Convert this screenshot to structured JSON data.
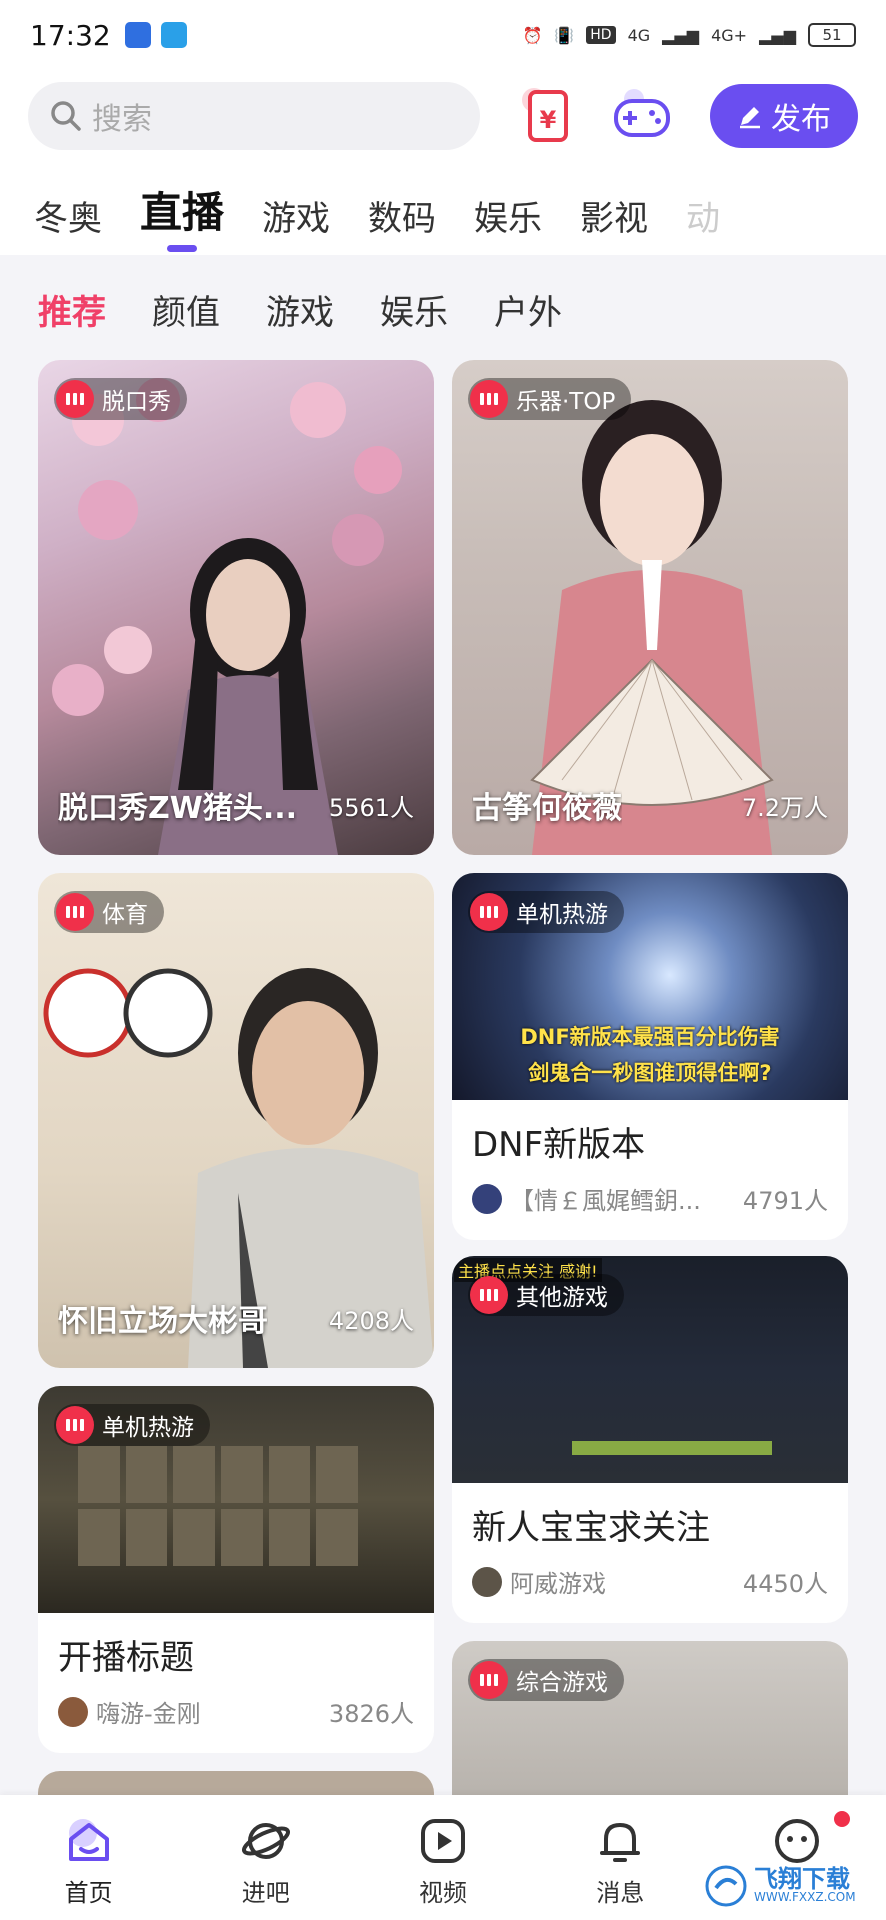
{
  "status_bar": {
    "time": "17:32",
    "hd": "HD",
    "net1": "4G",
    "net2": "4G+",
    "battery": "51"
  },
  "search": {
    "placeholder": "搜索"
  },
  "publish_label": "发布",
  "category_tabs": [
    "冬奥",
    "直播",
    "游戏",
    "数码",
    "娱乐",
    "影视",
    "动"
  ],
  "sub_tabs": [
    "推荐",
    "颜值",
    "游戏",
    "娱乐",
    "户外"
  ],
  "cards": [
    {
      "tag": "脱口秀",
      "title": "脱口秀ZW猪头...",
      "viewers": "5561人"
    },
    {
      "tag": "乐器·TOP",
      "title": "古筝何筱薇",
      "viewers": "7.2万人"
    },
    {
      "tag": "体育",
      "title": "怀旧立场大彬哥",
      "viewers": "4208人"
    },
    {
      "tag": "单机热游",
      "title": "DNF新版本",
      "streamer": "【情￡風娓鳕鈅...",
      "viewers": "4791人",
      "thumb_text1": "DNF新版本最强百分比伤害",
      "thumb_text2": "剑鬼合一秒图谁顶得住啊?"
    },
    {
      "tag": "其他游戏",
      "title": "新人宝宝求关注",
      "streamer": "阿威游戏",
      "viewers": "4450人",
      "thumb_text": "主播点点关注 感谢!"
    },
    {
      "tag": "单机热游",
      "title": "开播标题",
      "streamer": "嗨游-金刚",
      "viewers": "3826人"
    },
    {
      "tag": "综合游戏"
    }
  ],
  "bottom_nav": [
    {
      "label": "首页",
      "icon": "home-icon"
    },
    {
      "label": "进吧",
      "icon": "planet-icon"
    },
    {
      "label": "视频",
      "icon": "video-icon"
    },
    {
      "label": "消息",
      "icon": "bell-icon"
    },
    {
      "label": "",
      "icon": "smile-icon"
    }
  ],
  "watermark": {
    "text": "飞翔下载",
    "url": "WWW.FXXZ.COM"
  },
  "colors": {
    "accent": "#6a4ef0",
    "live_red": "#f0304a",
    "active_sub_tab": "#f04068"
  }
}
